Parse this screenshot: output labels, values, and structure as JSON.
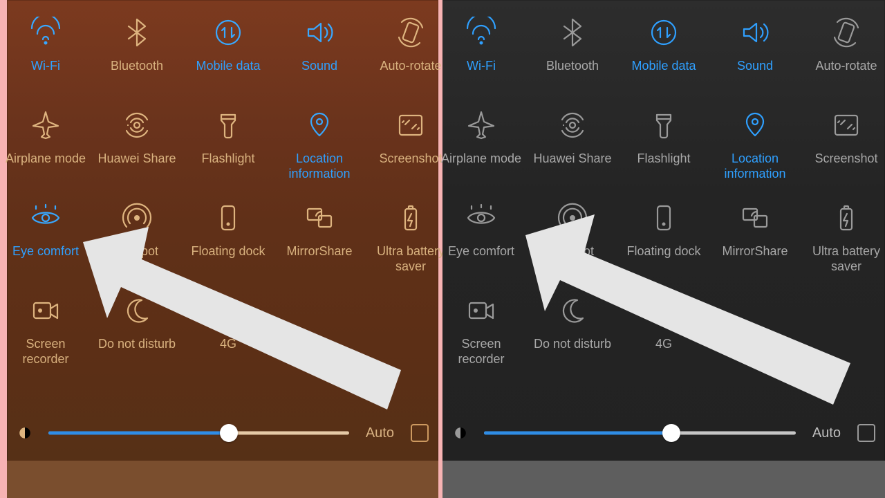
{
  "brightness": {
    "auto_label": "Auto",
    "percent": 60,
    "auto_checked": false
  },
  "tiles": [
    {
      "id": "wifi",
      "label": "Wi-Fi",
      "icon": "wifi",
      "active": true
    },
    {
      "id": "bluetooth",
      "label": "Bluetooth",
      "icon": "bluetooth",
      "active": false
    },
    {
      "id": "mobile-data",
      "label": "Mobile data",
      "icon": "mobiledata",
      "active": true
    },
    {
      "id": "sound",
      "label": "Sound",
      "icon": "sound",
      "active": true
    },
    {
      "id": "auto-rotate",
      "label": "Auto-rotate",
      "icon": "autorotate",
      "active": false
    },
    {
      "id": "airplane",
      "label": "Airplane mode",
      "icon": "airplane",
      "active": false
    },
    {
      "id": "huawei-share",
      "label": "Huawei Share",
      "icon": "share",
      "active": false
    },
    {
      "id": "flashlight",
      "label": "Flashlight",
      "icon": "flashlight",
      "active": false
    },
    {
      "id": "location",
      "label": "Location information",
      "icon": "location",
      "active": true
    },
    {
      "id": "screenshot",
      "label": "Screenshot",
      "icon": "screenshot",
      "active": false
    },
    {
      "id": "eye-comfort",
      "label": "Eye comfort",
      "icon": "eye",
      "active": true,
      "active_right": false
    },
    {
      "id": "hotspot",
      "label": "Hotspot",
      "icon": "hotspot",
      "active": false
    },
    {
      "id": "floating-dock",
      "label": "Floating dock",
      "icon": "dock",
      "active": false
    },
    {
      "id": "mirrorshare",
      "label": "MirrorShare",
      "icon": "mirror",
      "active": false
    },
    {
      "id": "battery-saver",
      "label": "Ultra battery saver",
      "icon": "battery",
      "active": false
    },
    {
      "id": "screen-rec",
      "label": "Screen recorder",
      "icon": "recorder",
      "active": false
    },
    {
      "id": "dnd",
      "label": "Do not disturb",
      "icon": "moon",
      "active": false
    },
    {
      "id": "4g",
      "label": "4G",
      "icon": "fourg",
      "active": false
    }
  ]
}
